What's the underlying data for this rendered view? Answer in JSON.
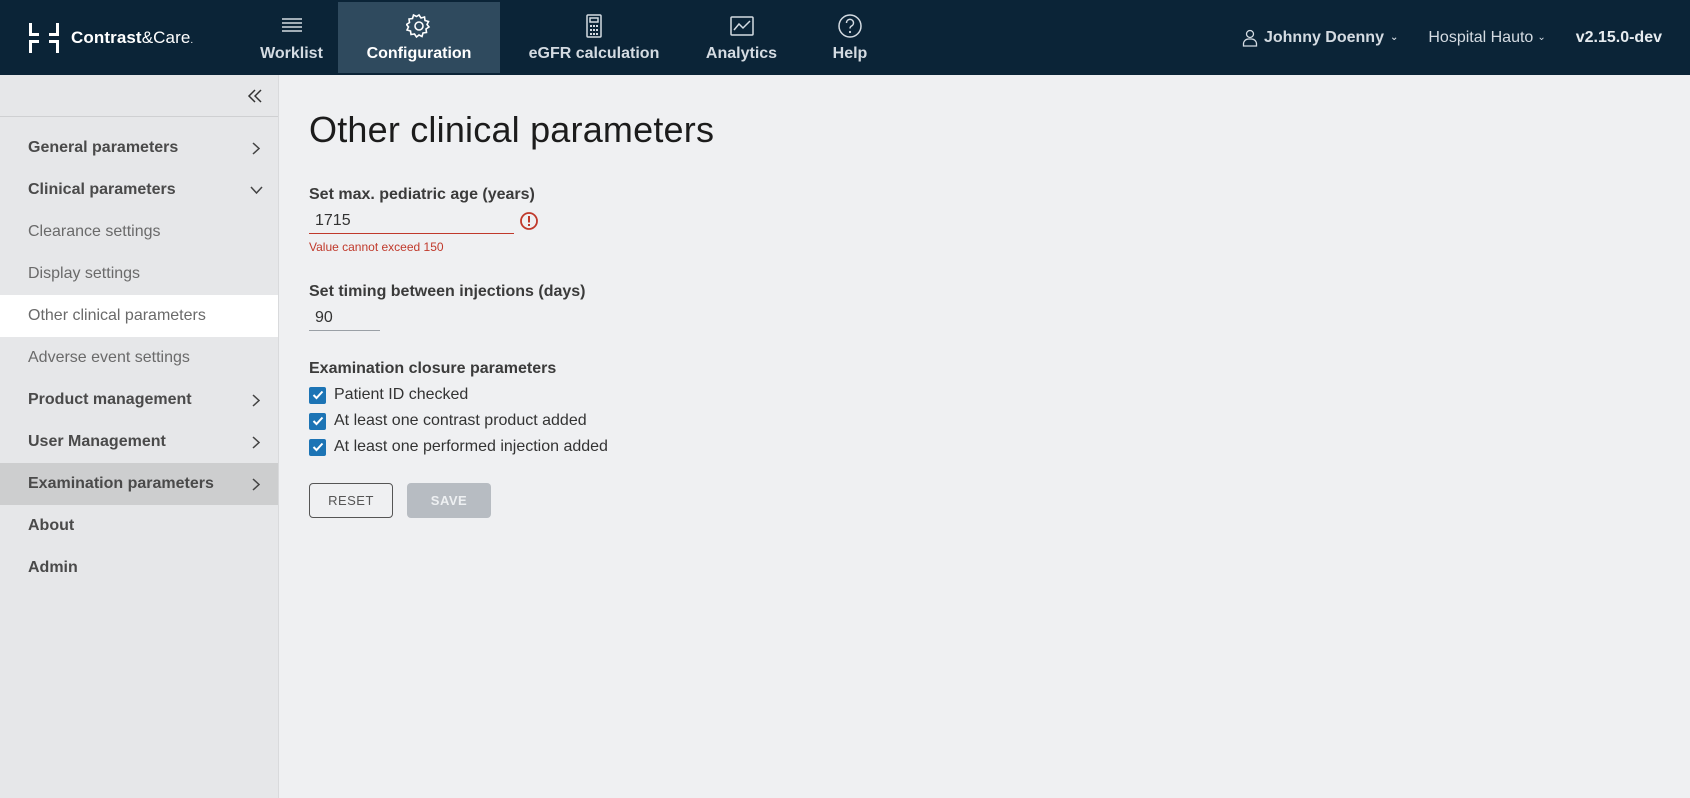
{
  "header": {
    "logo": {
      "brand_bold": "Contrast",
      "brand_amp": "&",
      "brand_care": "Care",
      "brand_suffix": "."
    },
    "nav": [
      {
        "label": "Worklist",
        "icon": "list-icon"
      },
      {
        "label": "Configuration",
        "icon": "gear-icon",
        "active": true
      },
      {
        "label": "eGFR calculation",
        "icon": "calculator-icon"
      },
      {
        "label": "Analytics",
        "icon": "chart-icon"
      },
      {
        "label": "Help",
        "icon": "help-icon"
      }
    ],
    "user": "Johnny Doenny",
    "hospital": "Hospital Hauto",
    "version": "v2.15.0-dev"
  },
  "sidebar": {
    "items": [
      {
        "label": "General parameters",
        "type": "section",
        "chevron": "right"
      },
      {
        "label": "Clinical parameters",
        "type": "section",
        "chevron": "down"
      },
      {
        "label": "Clearance settings",
        "type": "sub"
      },
      {
        "label": "Display settings",
        "type": "sub"
      },
      {
        "label": "Other clinical parameters",
        "type": "sub",
        "active": true
      },
      {
        "label": "Adverse event settings",
        "type": "sub"
      },
      {
        "label": "Product management",
        "type": "section",
        "chevron": "right"
      },
      {
        "label": "User Management",
        "type": "section",
        "chevron": "right"
      },
      {
        "label": "Examination parameters",
        "type": "section",
        "chevron": "right",
        "hover": true
      },
      {
        "label": "About",
        "type": "section"
      },
      {
        "label": "Admin",
        "type": "section"
      }
    ]
  },
  "main": {
    "title": "Other clinical parameters",
    "pediatric_age": {
      "label": "Set max. pediatric age (years)",
      "value": "1715",
      "error": "Value cannot exceed 150"
    },
    "injection_timing": {
      "label": "Set timing between injections (days)",
      "value": "90"
    },
    "closure": {
      "label": "Examination closure parameters",
      "options": [
        {
          "label": "Patient ID checked",
          "checked": true
        },
        {
          "label": "At least one contrast product added",
          "checked": true
        },
        {
          "label": "At least one performed injection added",
          "checked": true
        }
      ]
    },
    "buttons": {
      "reset": "RESET",
      "save": "SAVE"
    }
  },
  "colors": {
    "header_bg": "#0b2437",
    "nav_active_bg": "#2f4a5e",
    "accent": "#1c74b5",
    "error": "#c0392b",
    "disabled_button": "#b7bcc2"
  }
}
